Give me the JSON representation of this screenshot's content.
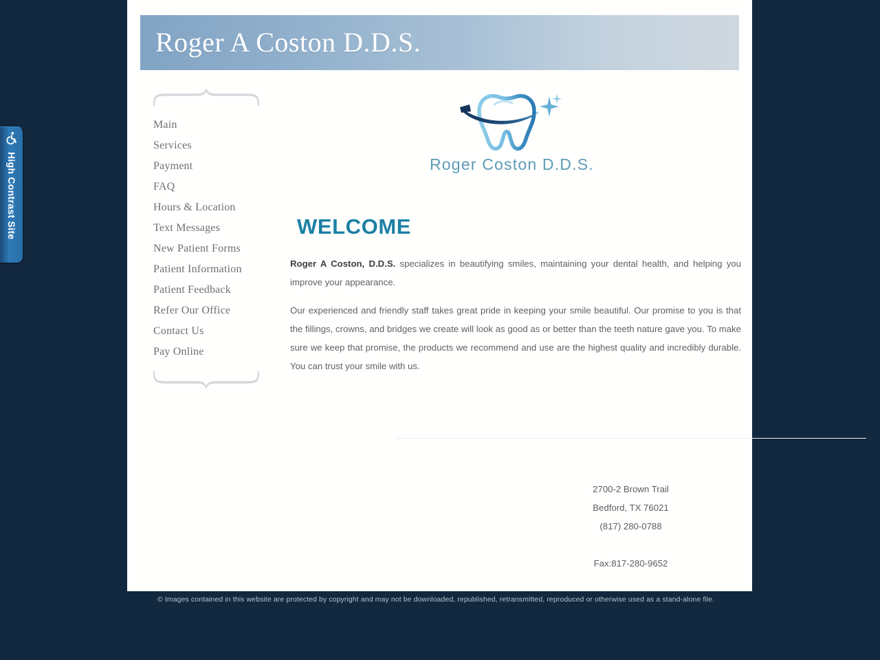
{
  "accessibility_tab": {
    "label": "High Contrast Site",
    "icon": "wheelchair-accessibility-icon",
    "color": "#2e7ab8"
  },
  "banner": {
    "title": "Roger A Coston D.D.S.",
    "gradient_from": "#82a4c4",
    "gradient_to": "#cfd8e0",
    "text_color": "#ffffff"
  },
  "sidebar": {
    "ornament_top": "curly-brace-ornament",
    "ornament_bottom": "curly-brace-ornament",
    "items": [
      {
        "label": "Main"
      },
      {
        "label": "Services"
      },
      {
        "label": "Payment"
      },
      {
        "label": "FAQ"
      },
      {
        "label": "Hours & Location"
      },
      {
        "label": "Text Messages"
      },
      {
        "label": "New Patient Forms"
      },
      {
        "label": "Patient Information"
      },
      {
        "label": "Patient Feedback"
      },
      {
        "label": "Refer Our Office"
      },
      {
        "label": "Contact Us"
      },
      {
        "label": "Pay Online"
      }
    ]
  },
  "logo": {
    "text": "Roger Coston D.D.S.",
    "text_color": "#5c9bb4",
    "tooth_light": "#7ec1e0",
    "tooth_dark": "#2b7ab5",
    "swoosh_color": "#17395f",
    "sparkle_color": "#58a8d4"
  },
  "content": {
    "heading": "WELCOME",
    "heading_color": "#1b81a3",
    "paragraph1_lead": "Roger A Coston, D.D.S.",
    "paragraph1_rest": " specializes in beautifying smiles, maintaining your dental health, and helping you improve your appearance.",
    "paragraph2": "Our experienced and friendly staff takes great pride in keeping your smile beautiful. Our promise to you is that the fillings, crowns, and bridges we create will look as good as or better than the teeth nature gave you. To make sure we keep that promise, the products we recommend and use are the highest quality and incredibly durable. You can trust your smile with us."
  },
  "address": {
    "street": "2700-2 Brown Trail",
    "city_state_zip": "Bedford, TX 76021",
    "phone": "(817) 280-0788",
    "fax": "Fax:817-280-9652"
  },
  "copyright": {
    "text": "© Images contained in this website are protected by copyright and may not be downloaded, republished, retransmitted, reproduced or otherwise used as a stand-alone file."
  },
  "page_background": "#12283f"
}
